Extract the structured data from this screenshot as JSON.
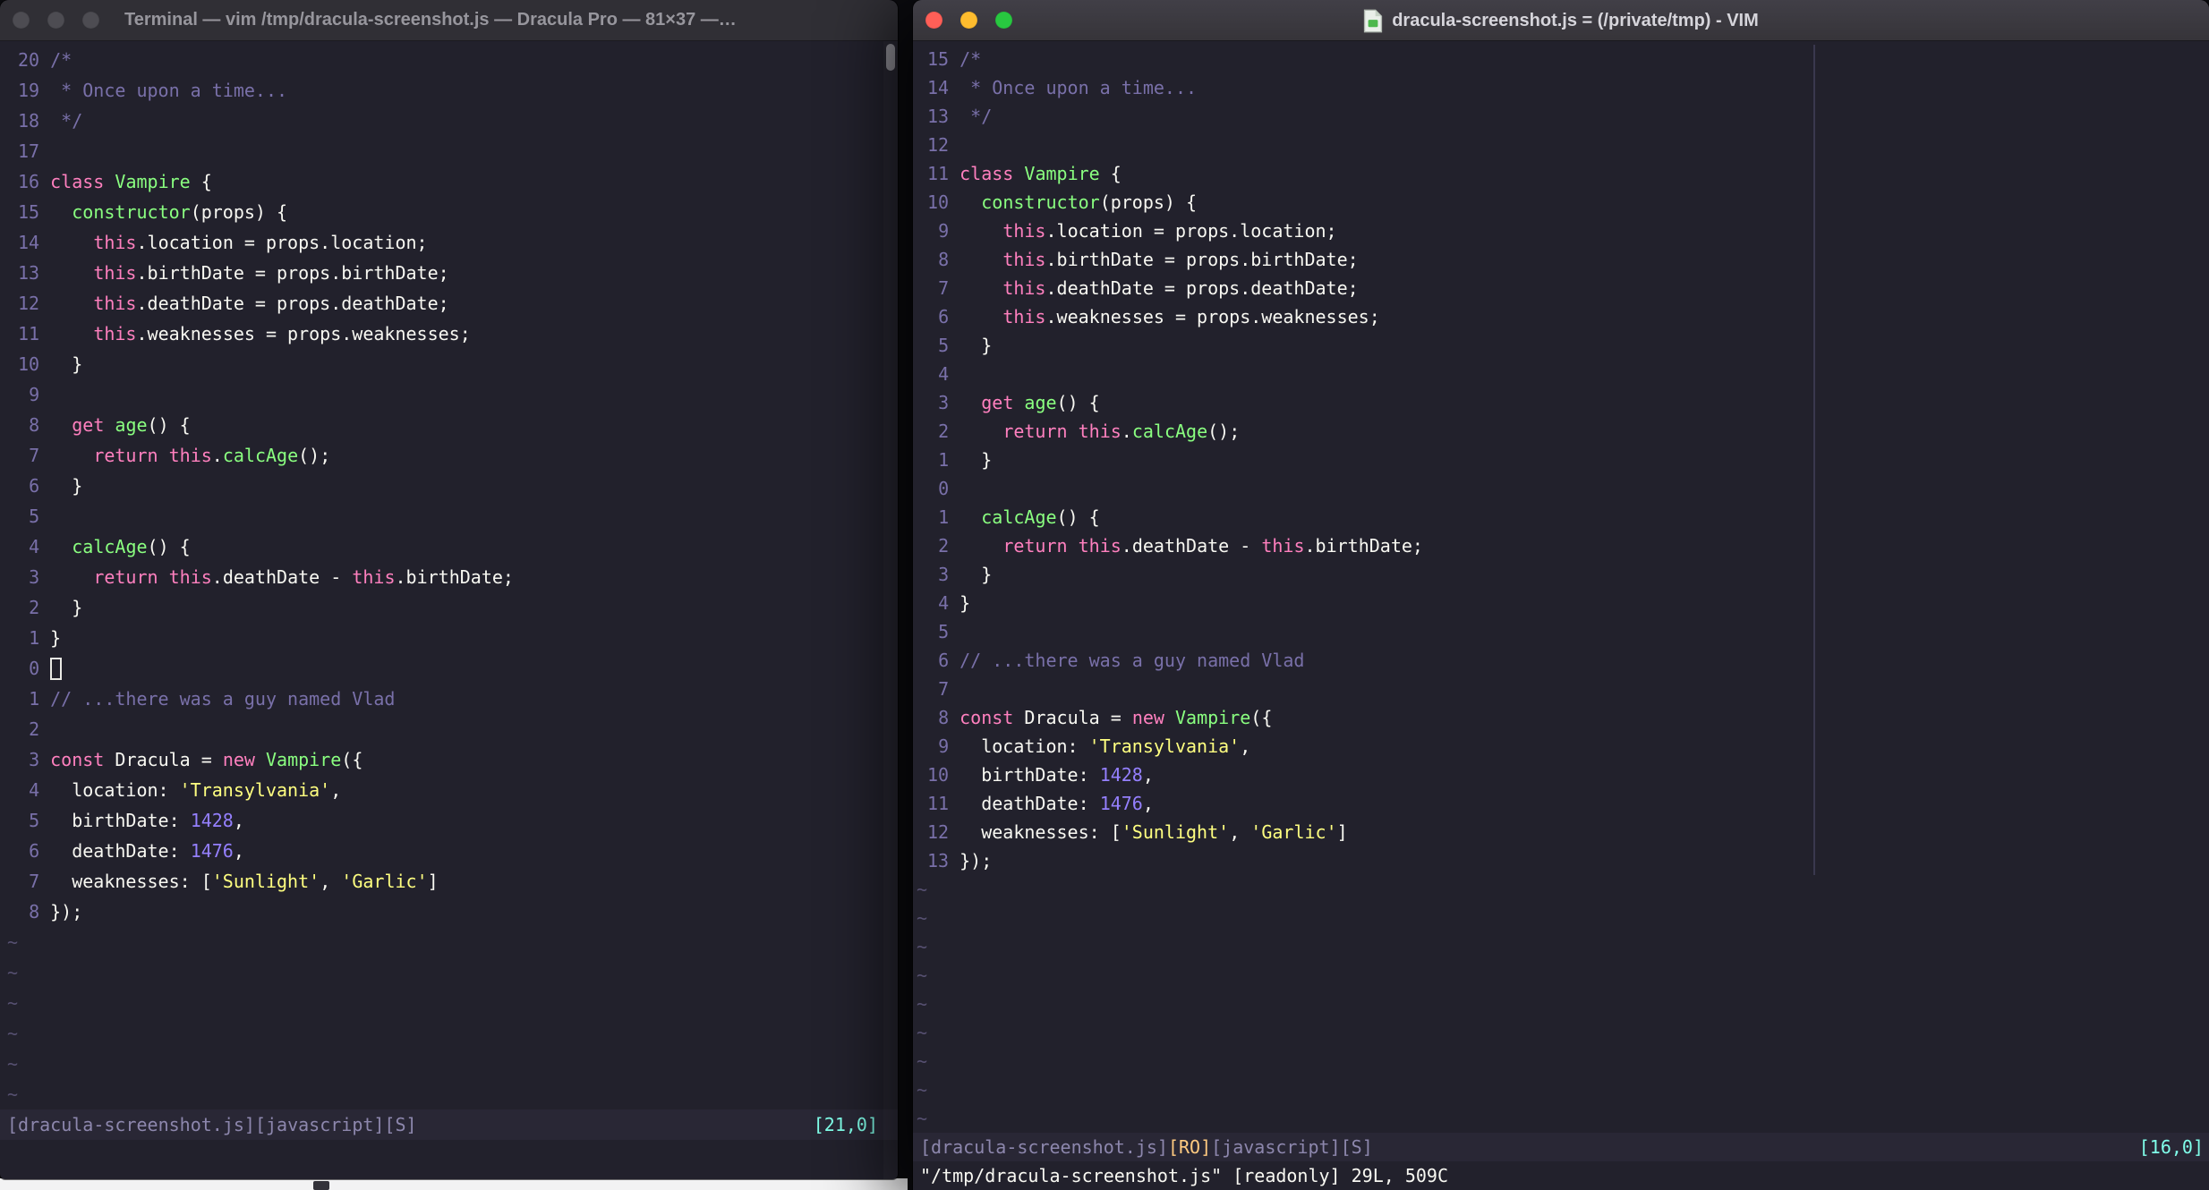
{
  "colors": {
    "background": "#22212C",
    "foreground": "#F8F8F2",
    "comment": "#7970A9",
    "pink": "#FF80BF",
    "green": "#8AFF80",
    "purple": "#9580FF",
    "yellow": "#FFFF80",
    "cyan": "#80FFEA",
    "orange": "#FFCA80",
    "line_number": "#7970A9",
    "nontext": "#565071",
    "status_text": "#8D87AD"
  },
  "left_window": {
    "app": "Terminal",
    "title": "Terminal — vim /tmp/dracula-screenshot.js — Dracula Pro — 81×37 —…",
    "statusline_left": "[dracula-screenshot.js][javascript][S]",
    "ruler": "[21,0]",
    "cursor_line": 21,
    "tilde_count": 6,
    "cursor_style": "hollow"
  },
  "right_window": {
    "app": "MacVim",
    "title": "dracula-screenshot.js = (/private/tmp) - VIM",
    "statusline_file": "[dracula-screenshot.js]",
    "statusline_ro": "[RO]",
    "statusline_rest": "[javascript][S]",
    "ruler": "[16,0]",
    "cmdline": "\"/tmp/dracula-screenshot.js\" [readonly] 29L, 509C",
    "cursor_line": 16,
    "tilde_count": 9,
    "cursor_style": "none"
  },
  "code": {
    "language": "javascript",
    "token_styles": {
      "c": "comment",
      "k": "keyword",
      "f": "function-name",
      "s": "string",
      "n": "number",
      "d": "default"
    },
    "lines": [
      [
        [
          "c",
          "/*"
        ]
      ],
      [
        [
          "c",
          " * Once upon a time..."
        ]
      ],
      [
        [
          "c",
          " */"
        ]
      ],
      [],
      [
        [
          "k",
          "class"
        ],
        [
          "d",
          " "
        ],
        [
          "f",
          "Vampire"
        ],
        [
          "d",
          " {"
        ]
      ],
      [
        [
          "d",
          "  "
        ],
        [
          "f",
          "constructor"
        ],
        [
          "d",
          "(props) {"
        ]
      ],
      [
        [
          "d",
          "    "
        ],
        [
          "k",
          "this"
        ],
        [
          "d",
          ".location = props.location;"
        ]
      ],
      [
        [
          "d",
          "    "
        ],
        [
          "k",
          "this"
        ],
        [
          "d",
          ".birthDate = props.birthDate;"
        ]
      ],
      [
        [
          "d",
          "    "
        ],
        [
          "k",
          "this"
        ],
        [
          "d",
          ".deathDate = props.deathDate;"
        ]
      ],
      [
        [
          "d",
          "    "
        ],
        [
          "k",
          "this"
        ],
        [
          "d",
          ".weaknesses = props.weaknesses;"
        ]
      ],
      [
        [
          "d",
          "  }"
        ]
      ],
      [],
      [
        [
          "d",
          "  "
        ],
        [
          "k",
          "get"
        ],
        [
          "d",
          " "
        ],
        [
          "f",
          "age"
        ],
        [
          "d",
          "() {"
        ]
      ],
      [
        [
          "d",
          "    "
        ],
        [
          "k",
          "return"
        ],
        [
          "d",
          " "
        ],
        [
          "k",
          "this"
        ],
        [
          "d",
          "."
        ],
        [
          "f",
          "calcAge"
        ],
        [
          "d",
          "();"
        ]
      ],
      [
        [
          "d",
          "  }"
        ]
      ],
      [],
      [
        [
          "d",
          "  "
        ],
        [
          "f",
          "calcAge"
        ],
        [
          "d",
          "() {"
        ]
      ],
      [
        [
          "d",
          "    "
        ],
        [
          "k",
          "return"
        ],
        [
          "d",
          " "
        ],
        [
          "k",
          "this"
        ],
        [
          "d",
          ".deathDate - "
        ],
        [
          "k",
          "this"
        ],
        [
          "d",
          ".birthDate;"
        ]
      ],
      [
        [
          "d",
          "  }"
        ]
      ],
      [
        [
          "d",
          "}"
        ]
      ],
      [],
      [
        [
          "c",
          "// ...there was a guy named Vlad"
        ]
      ],
      [],
      [
        [
          "k",
          "const"
        ],
        [
          "d",
          " Dracula = "
        ],
        [
          "k",
          "new"
        ],
        [
          "d",
          " "
        ],
        [
          "f",
          "Vampire"
        ],
        [
          "d",
          "({"
        ]
      ],
      [
        [
          "d",
          "  location: "
        ],
        [
          "s",
          "'Transylvania'"
        ],
        [
          "d",
          ","
        ]
      ],
      [
        [
          "d",
          "  birthDate: "
        ],
        [
          "n",
          "1428"
        ],
        [
          "d",
          ","
        ]
      ],
      [
        [
          "d",
          "  deathDate: "
        ],
        [
          "n",
          "1476"
        ],
        [
          "d",
          ","
        ]
      ],
      [
        [
          "d",
          "  weaknesses: ["
        ],
        [
          "s",
          "'Sunlight'"
        ],
        [
          "d",
          ", "
        ],
        [
          "s",
          "'Garlic'"
        ],
        [
          "d",
          "]"
        ]
      ],
      [
        [
          "d",
          "});"
        ]
      ]
    ]
  }
}
